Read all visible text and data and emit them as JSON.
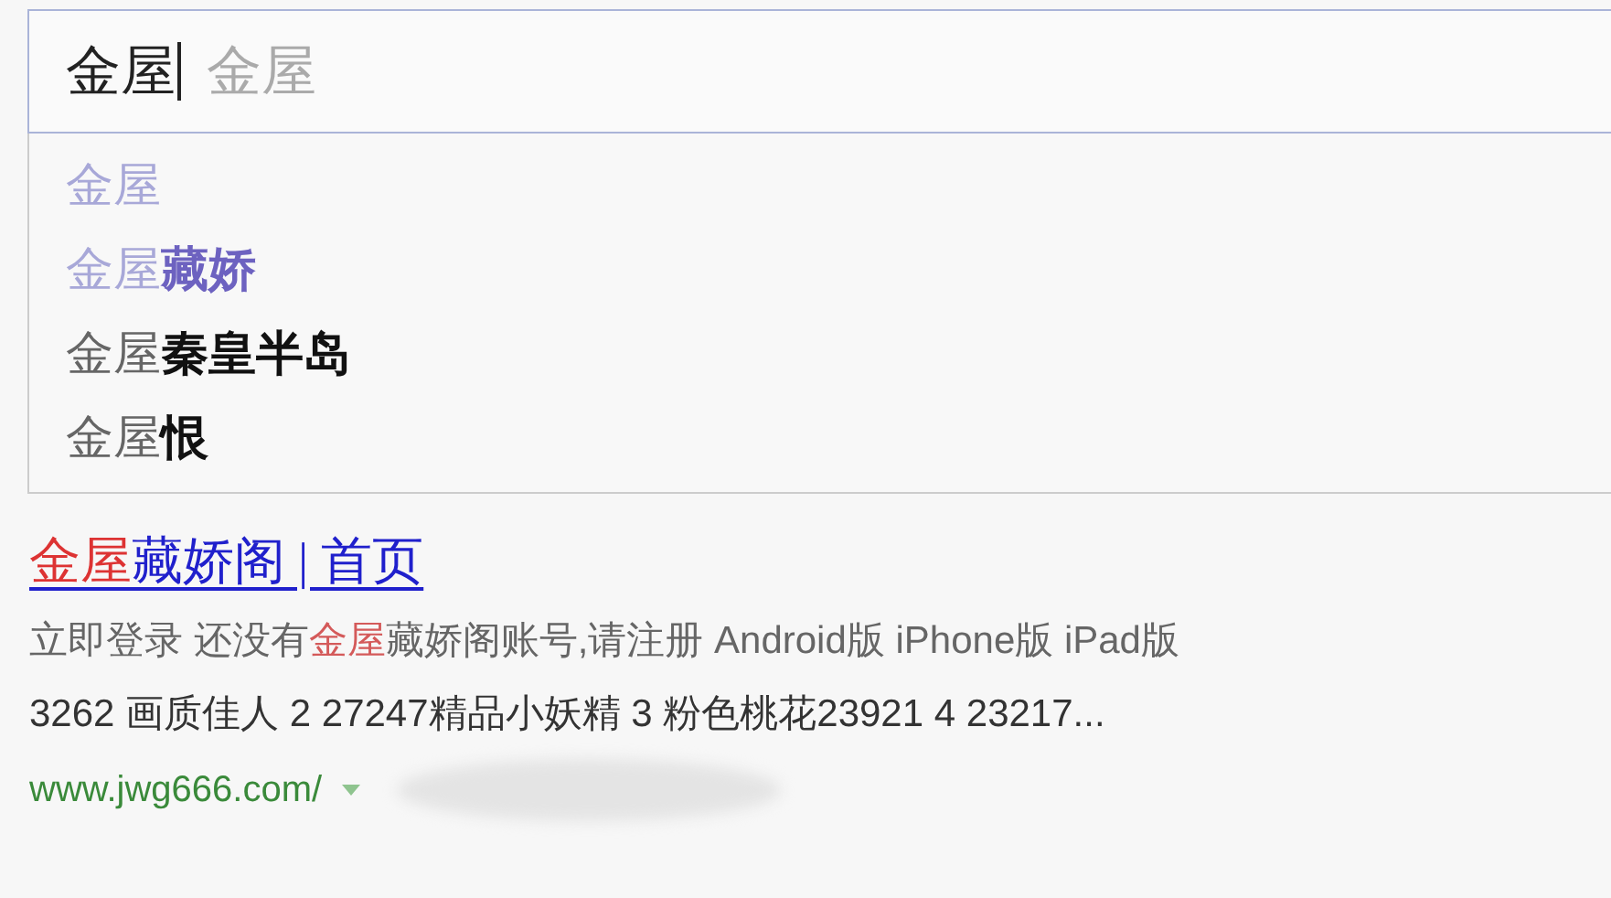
{
  "search": {
    "value": "金屋",
    "hint": "金屋"
  },
  "suggestions": [
    {
      "prefix": "金屋",
      "visited": true
    },
    {
      "prefix": "金屋",
      "suffix": "藏娇",
      "visited": true
    },
    {
      "prefix": "金屋",
      "suffix": "秦皇半岛",
      "visited": false
    },
    {
      "prefix": "金屋",
      "suffix": "恨",
      "visited": false
    }
  ],
  "result": {
    "title": [
      {
        "text": "金屋",
        "highlight": true
      },
      {
        "text": "藏娇阁 | 首页",
        "highlight": false
      }
    ],
    "snippet": [
      {
        "text": "立即登录 还没有",
        "highlight": false
      },
      {
        "text": "金屋",
        "highlight": true
      },
      {
        "text": "藏娇阁账号,请注册 Android版 iPhone版 iPad版",
        "highlight": false
      }
    ],
    "snippet_line_2": "3262 画质佳人 2 27247精品小妖精 3 粉色桃花23921 4 23217...",
    "url": "www.jwg666.com/"
  }
}
